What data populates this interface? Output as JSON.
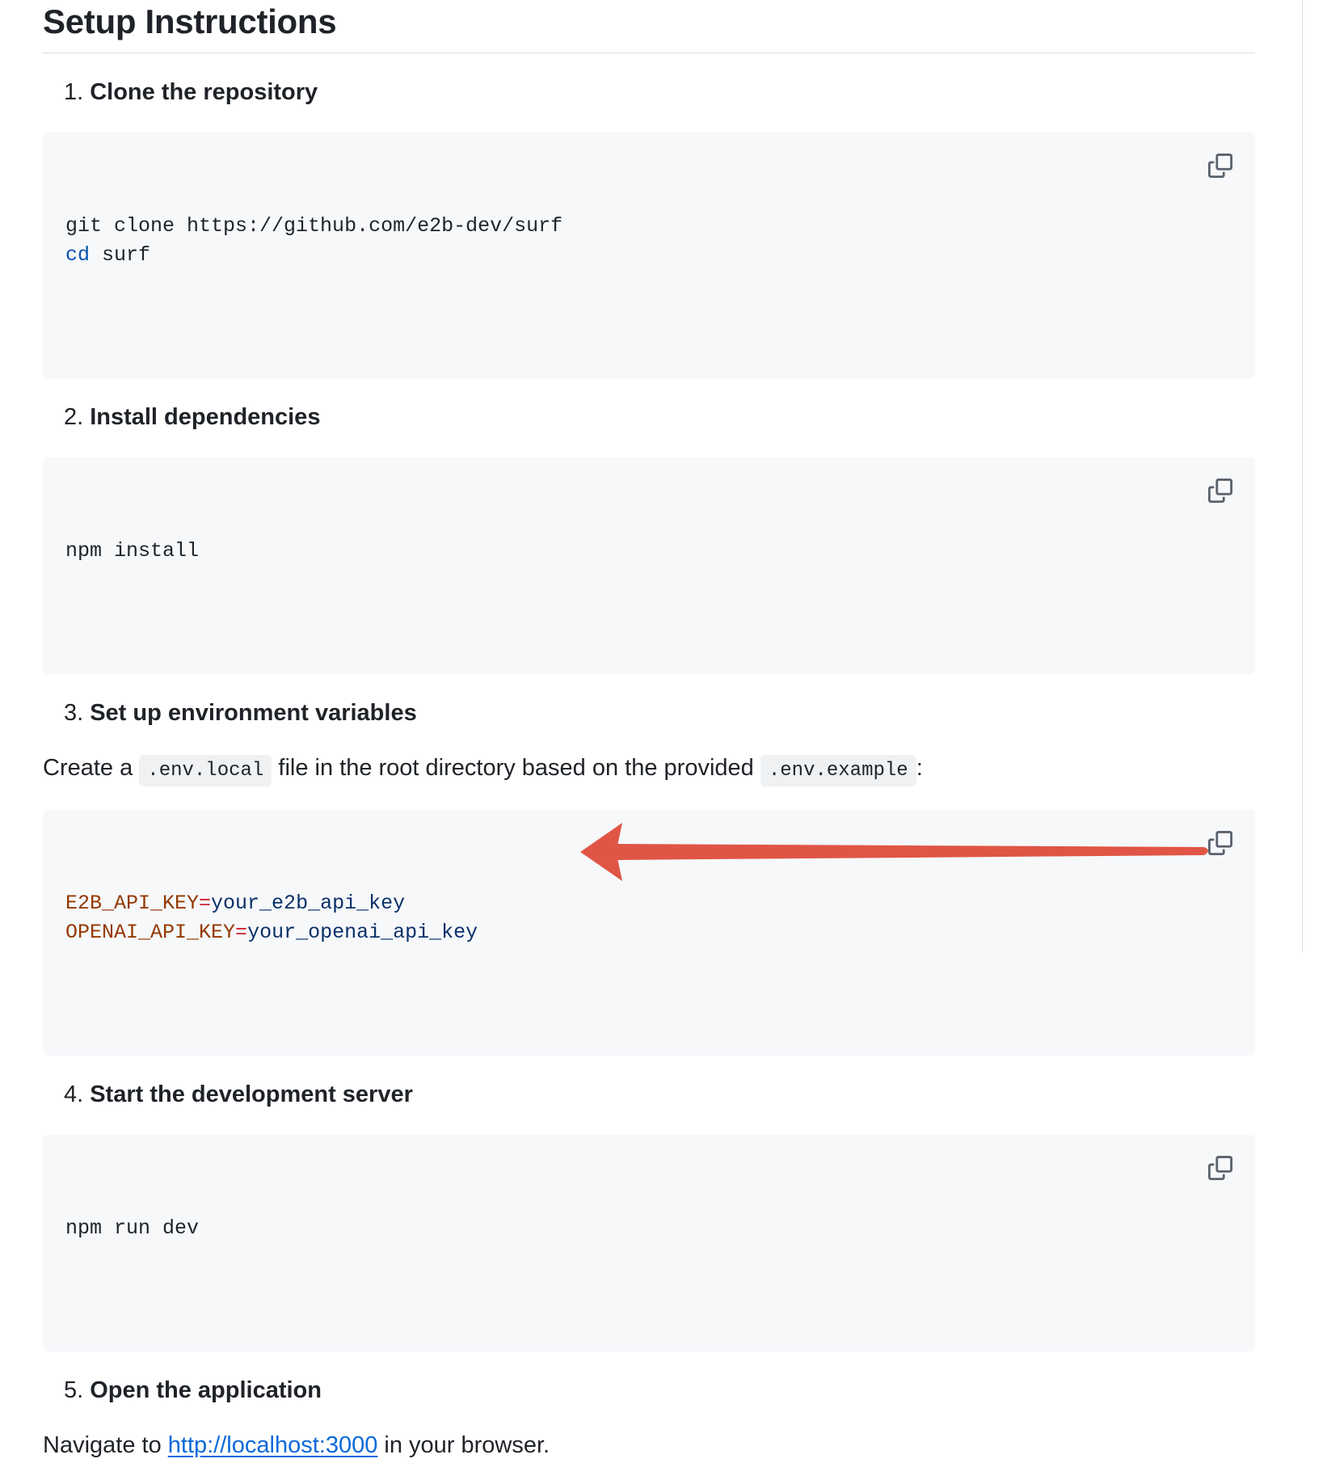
{
  "heading": "Setup Instructions",
  "steps": [
    {
      "number": "1.",
      "title": "Clone the repository",
      "code": [
        {
          "cmd": "git",
          "rest": " clone https://github.com/e2b-dev/surf"
        },
        {
          "cmd": "cd",
          "rest": " surf"
        }
      ]
    },
    {
      "number": "2.",
      "title": "Install dependencies",
      "code": "npm install"
    },
    {
      "number": "3.",
      "title": "Set up environment variables",
      "para": {
        "before": "Create a ",
        "code1": ".env.local",
        "middle": " file in the root directory based on the provided ",
        "code2": ".env.example",
        "after": ":"
      },
      "env": [
        {
          "key": "E2B_API_KEY",
          "eq": "=",
          "value": "your_e2b_api_key"
        },
        {
          "key": "OPENAI_API_KEY",
          "eq": "=",
          "value": "your_openai_api_key"
        }
      ]
    },
    {
      "number": "4.",
      "title": "Start the development server",
      "code": "npm run dev"
    },
    {
      "number": "5.",
      "title": "Open the application",
      "para": {
        "before": "Navigate to ",
        "link": "http://localhost:3000",
        "after": " in your browser."
      }
    }
  ],
  "icons": {
    "copy": "copy-icon",
    "annotation": "red-arrow-annotation"
  },
  "colors": {
    "code_bg": "#f6f8fa",
    "keyword": "#0550ae",
    "env_key": "#953800",
    "env_eq": "#cf222e",
    "env_value": "#0a3069",
    "link": "#0969da",
    "arrow": "#e05545"
  }
}
